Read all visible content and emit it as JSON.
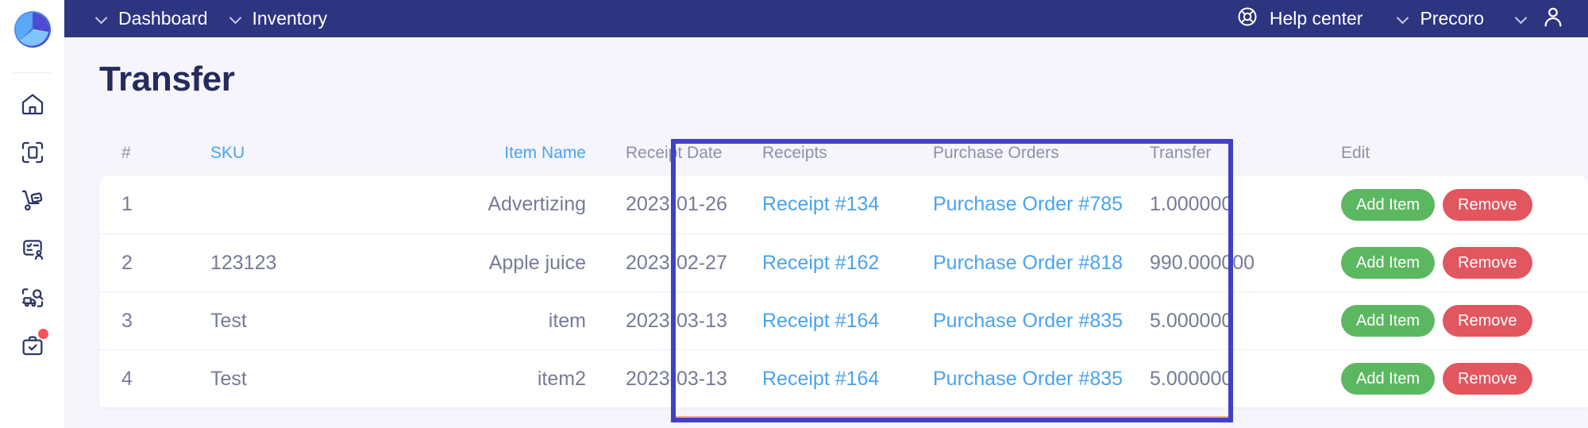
{
  "app": {
    "brand": "Precoro",
    "logo_icon": "precoro-pinwheel-logo"
  },
  "topbar": {
    "breadcrumbs": [
      {
        "label": "Dashboard",
        "icon": "chevron-down-icon"
      },
      {
        "label": "Inventory",
        "icon": "chevron-down-icon"
      }
    ],
    "help_center": {
      "label": "Help center",
      "icon": "lifebuoy-icon"
    },
    "account": {
      "label": "Precoro",
      "icon": "chevron-down-icon"
    },
    "avatar": {
      "icon": "user-avatar-icon"
    }
  },
  "sidebar": {
    "items": [
      {
        "name": "home",
        "icon": "home-icon",
        "badge": false
      },
      {
        "name": "documents",
        "icon": "document-scan-icon",
        "badge": false
      },
      {
        "name": "receiving",
        "icon": "hand-truck-icon",
        "badge": false
      },
      {
        "name": "invoices",
        "icon": "invoice-person-icon",
        "badge": false
      },
      {
        "name": "tracking",
        "icon": "truck-search-icon",
        "badge": false
      },
      {
        "name": "tasks",
        "icon": "briefcase-check-icon",
        "badge": true
      }
    ]
  },
  "main": {
    "page_title": "Transfer",
    "table": {
      "columns": [
        {
          "key": "num",
          "label": "#",
          "link": false
        },
        {
          "key": "sku",
          "label": "SKU",
          "link": true
        },
        {
          "key": "name",
          "label": "Item Name",
          "link": true
        },
        {
          "key": "date",
          "label": "Receipt Date",
          "link": false
        },
        {
          "key": "rec",
          "label": "Receipts",
          "link": false
        },
        {
          "key": "po",
          "label": "Purchase Orders",
          "link": false
        },
        {
          "key": "tr",
          "label": "Transfer",
          "link": false
        },
        {
          "key": "edit",
          "label": "Edit",
          "link": false
        }
      ],
      "rows": [
        {
          "num": "1",
          "sku": "",
          "name": "Advertizing",
          "date": "2023-01-26",
          "receipt": "Receipt #134",
          "purchase_order": "Purchase Order #785",
          "transfer": "1.000000",
          "add_label": "Add Item",
          "remove_label": "Remove"
        },
        {
          "num": "2",
          "sku": "123123",
          "name": "Apple juice",
          "date": "2023-02-27",
          "receipt": "Receipt #162",
          "purchase_order": "Purchase Order #818",
          "transfer": "990.000000",
          "add_label": "Add Item",
          "remove_label": "Remove"
        },
        {
          "num": "3",
          "sku": "Test",
          "name": "item",
          "date": "2023-03-13",
          "receipt": "Receipt #164",
          "purchase_order": "Purchase Order #835",
          "transfer": "5.000000",
          "add_label": "Add Item",
          "remove_label": "Remove"
        },
        {
          "num": "4",
          "sku": "Test",
          "name": "item2",
          "date": "2023-03-13",
          "receipt": "Receipt #164",
          "purchase_order": "Purchase Order #835",
          "transfer": "5.000000",
          "add_label": "Add Item",
          "remove_label": "Remove"
        }
      ]
    }
  },
  "annotation": {
    "highlight_box": {
      "covers_columns": "Receipt Date, Receipts, Purchase Orders",
      "color": "#4040c8"
    }
  },
  "colors": {
    "header_bar": "#2d3480",
    "page_bg": "#f5f5fb",
    "title": "#252b5c",
    "link": "#4aa3f0",
    "muted_text": "#767b96",
    "header_text": "#8d90a8",
    "add_button": "#5cb860",
    "remove_button": "#e2565f",
    "highlight": "#4040c8",
    "badge": "#f4525d"
  }
}
